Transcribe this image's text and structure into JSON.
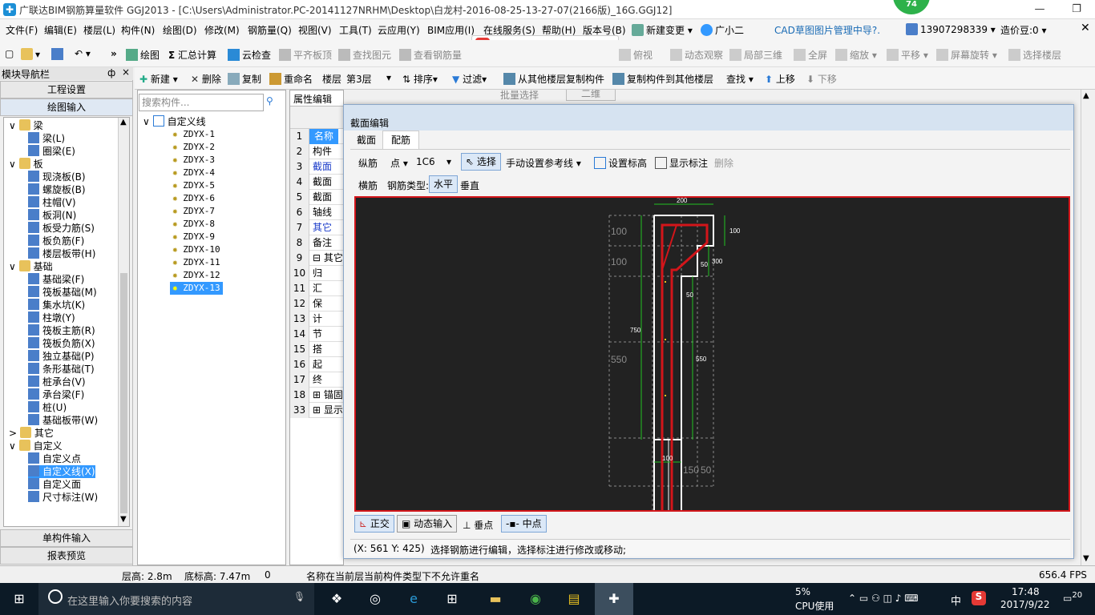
{
  "window": {
    "title": "广联达BIM钢筋算量软件 GGJ2013 - [C:\\Users\\Administrator.PC-20141127NRHM\\Desktop\\白龙村-2016-08-25-13-27-07(2166版)_16G.GGJ12]",
    "badge": "74",
    "minimize": "—",
    "restore": "❐",
    "close": "✕"
  },
  "menu": [
    "文件(F)",
    "编辑(E)",
    "楼层(L)",
    "构件(N)",
    "绘图(D)",
    "修改(M)",
    "钢筋量(Q)",
    "视图(V)",
    "工具(T)",
    "云应用(Y)",
    "BIM应用(I)",
    "在线服务(S)",
    "帮助(H)",
    "版本号(B)",
    "新建变更",
    "广小二",
    "CAD草图图片管理中导?.",
    "13907298339",
    "造价豆:0"
  ],
  "toolbar1": {
    "draw": "绘图",
    "sum": "汇总计算",
    "cloud_check": "云检查",
    "flat_top": "平齐板顶",
    "find_elem": "查找图元",
    "view_rebar": "查看钢筋量",
    "batch_select": "批量选择",
    "dim": "二维",
    "top_view": "俯视",
    "dyn_view": "动态观察",
    "local_3d": "局部三维",
    "fullscreen": "全屏",
    "zoom": "缩放",
    "pan": "平移",
    "screen_rotate": "屏幕旋转",
    "select_floor": "选择楼层"
  },
  "toolbar2": {
    "new": "新建",
    "delete": "删除",
    "copy": "复制",
    "rename": "重命名",
    "floor_label": "楼层",
    "floor_value": "第3层",
    "sort": "排序",
    "filter": "过滤",
    "copy_from": "从其他楼层复制构件",
    "copy_to": "复制构件到其他楼层",
    "find": "查找",
    "up": "上移",
    "down": "下移"
  },
  "nav": {
    "header": "模块导航栏",
    "pin": "ф",
    "close": "×",
    "project_settings": "工程设置",
    "draw_input": "绘图输入",
    "single_input": "单构件输入",
    "report_preview": "报表预览",
    "tree": [
      {
        "label": "梁",
        "level": 0,
        "kind": "folder",
        "exp": "∨"
      },
      {
        "label": "梁(L)",
        "level": 1,
        "kind": "item"
      },
      {
        "label": "圈梁(E)",
        "level": 1,
        "kind": "item"
      },
      {
        "label": "板",
        "level": 0,
        "kind": "folder",
        "exp": "∨"
      },
      {
        "label": "现浇板(B)",
        "level": 1,
        "kind": "item"
      },
      {
        "label": "螺旋板(B)",
        "level": 1,
        "kind": "item"
      },
      {
        "label": "柱帽(V)",
        "level": 1,
        "kind": "item"
      },
      {
        "label": "板洞(N)",
        "level": 1,
        "kind": "item"
      },
      {
        "label": "板受力筋(S)",
        "level": 1,
        "kind": "item"
      },
      {
        "label": "板负筋(F)",
        "level": 1,
        "kind": "item"
      },
      {
        "label": "楼层板带(H)",
        "level": 1,
        "kind": "item"
      },
      {
        "label": "基础",
        "level": 0,
        "kind": "folder",
        "exp": "∨"
      },
      {
        "label": "基础梁(F)",
        "level": 1,
        "kind": "item"
      },
      {
        "label": "筏板基础(M)",
        "level": 1,
        "kind": "item"
      },
      {
        "label": "集水坑(K)",
        "level": 1,
        "kind": "item"
      },
      {
        "label": "柱墩(Y)",
        "level": 1,
        "kind": "item"
      },
      {
        "label": "筏板主筋(R)",
        "level": 1,
        "kind": "item"
      },
      {
        "label": "筏板负筋(X)",
        "level": 1,
        "kind": "item"
      },
      {
        "label": "独立基础(P)",
        "level": 1,
        "kind": "item"
      },
      {
        "label": "条形基础(T)",
        "level": 1,
        "kind": "item"
      },
      {
        "label": "桩承台(V)",
        "level": 1,
        "kind": "item"
      },
      {
        "label": "承台梁(F)",
        "level": 1,
        "kind": "item"
      },
      {
        "label": "桩(U)",
        "level": 1,
        "kind": "item"
      },
      {
        "label": "基础板带(W)",
        "level": 1,
        "kind": "item"
      },
      {
        "label": "其它",
        "level": 0,
        "kind": "folder",
        "exp": ">"
      },
      {
        "label": "自定义",
        "level": 0,
        "kind": "folder",
        "exp": "∨"
      },
      {
        "label": "自定义点",
        "level": 1,
        "kind": "item"
      },
      {
        "label": "自定义线(X)",
        "level": 1,
        "kind": "item",
        "selected": true
      },
      {
        "label": "自定义面",
        "level": 1,
        "kind": "item"
      },
      {
        "label": "尺寸标注(W)",
        "level": 1,
        "kind": "item"
      }
    ]
  },
  "components": {
    "search_placeholder": "搜索构件...",
    "root": "自定义线",
    "items": [
      "ZDYX-1",
      "ZDYX-2",
      "ZDYX-3",
      "ZDYX-4",
      "ZDYX-5",
      "ZDYX-6",
      "ZDYX-7",
      "ZDYX-8",
      "ZDYX-9",
      "ZDYX-10",
      "ZDYX-11",
      "ZDYX-12",
      "ZDYX-13"
    ],
    "selected": "ZDYX-13"
  },
  "props": {
    "tab": "属性编辑",
    "rows": [
      {
        "n": "1",
        "t": "名称"
      },
      {
        "n": "2",
        "t": "构件"
      },
      {
        "n": "3",
        "t": "截面"
      },
      {
        "n": "4",
        "t": "截面"
      },
      {
        "n": "5",
        "t": "截面"
      },
      {
        "n": "6",
        "t": "轴线"
      },
      {
        "n": "7",
        "t": "其它"
      },
      {
        "n": "8",
        "t": "备注"
      },
      {
        "n": "9",
        "t": "⊟ 其它"
      },
      {
        "n": "10",
        "t": "归"
      },
      {
        "n": "11",
        "t": "汇"
      },
      {
        "n": "12",
        "t": "保"
      },
      {
        "n": "13",
        "t": "计"
      },
      {
        "n": "14",
        "t": "节"
      },
      {
        "n": "15",
        "t": "搭"
      },
      {
        "n": "16",
        "t": "起"
      },
      {
        "n": "17",
        "t": "终"
      },
      {
        "n": "18",
        "t": "⊞ 锚固"
      },
      {
        "n": "33",
        "t": "⊞ 显示"
      }
    ]
  },
  "dialog": {
    "title": "截面编辑",
    "tabs": [
      "截面",
      "配筋"
    ],
    "row1": {
      "long_bar": "纵筋",
      "point": "点",
      "bar_spec": "1C6",
      "select": "选择",
      "manual_ref": "手动设置参考线",
      "set_elev": "设置标高",
      "show_dim": "显示标注",
      "delete": "删除"
    },
    "row2": {
      "transverse": "横筋",
      "rebar_type_label": "钢筋类型:",
      "horizontal": "水平",
      "vertical": "垂直"
    },
    "dims": {
      "top_width": "200",
      "left_100a": "100",
      "left_100b": "100",
      "right_100": "100",
      "right_300": "300",
      "d50a": "50",
      "d50b": "50",
      "left_750": "750",
      "left_550": "550",
      "right_550": "550",
      "b100": "100",
      "b150": "150",
      "b50": "50"
    },
    "bottom": {
      "ortho": "正交",
      "dyn_input": "动态输入",
      "perp": "垂点",
      "mid": "中点"
    },
    "coords": "(X: 561 Y: 425)",
    "hint": "选择钢筋进行编辑，选择标注进行修改或移动;"
  },
  "status": {
    "floor_height": "层高: 2.8m",
    "base_elev": "底标高: 7.47m",
    "zero": "0",
    "message": "名称在当前层当前构件类型下不允许重名",
    "fps": "656.4 FPS"
  },
  "taskbar": {
    "search": "在这里输入你要搜索的内容",
    "cpu_pct": "5%",
    "cpu_label": "CPU使用",
    "ime": "中",
    "time": "17:48",
    "date": "2017/9/22",
    "notif": "20"
  },
  "colors": {
    "accent": "#3399ff",
    "canvas_bg": "#222222",
    "canvas_border": "#d3151a",
    "rebar": "#d3151a",
    "dim_line": "#22c222",
    "outline": "#ffffff"
  }
}
